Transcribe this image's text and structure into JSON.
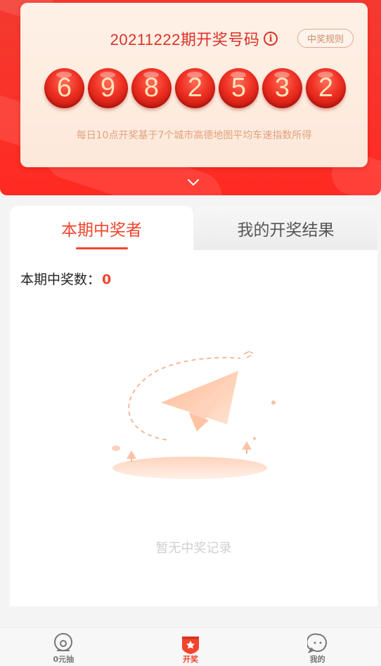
{
  "draw": {
    "period_title": "20211222期开奖号码",
    "rules_label": "中奖规则",
    "numbers": [
      "6",
      "9",
      "8",
      "2",
      "5",
      "3",
      "2"
    ],
    "note": "每日10点开奖基于7个城市高德地图平均车速指数所得"
  },
  "tabs": [
    {
      "label": "本期中奖者",
      "active": true
    },
    {
      "label": "我的开奖结果",
      "active": false
    }
  ],
  "winners": {
    "count_label": "本期中奖数：",
    "count_value": "0",
    "empty_text": "暂无中奖记录"
  },
  "bottom_nav": [
    {
      "label": "0元抽",
      "icon": "lottery-icon",
      "active": false
    },
    {
      "label": "开奖",
      "icon": "award-badge-icon",
      "active": true
    },
    {
      "label": "我的",
      "icon": "profile-face-icon",
      "active": false
    }
  ],
  "colors": {
    "brand_red": "#f2442d",
    "header_red": "#ff2a22",
    "ball_text": "#ffe3b8"
  }
}
